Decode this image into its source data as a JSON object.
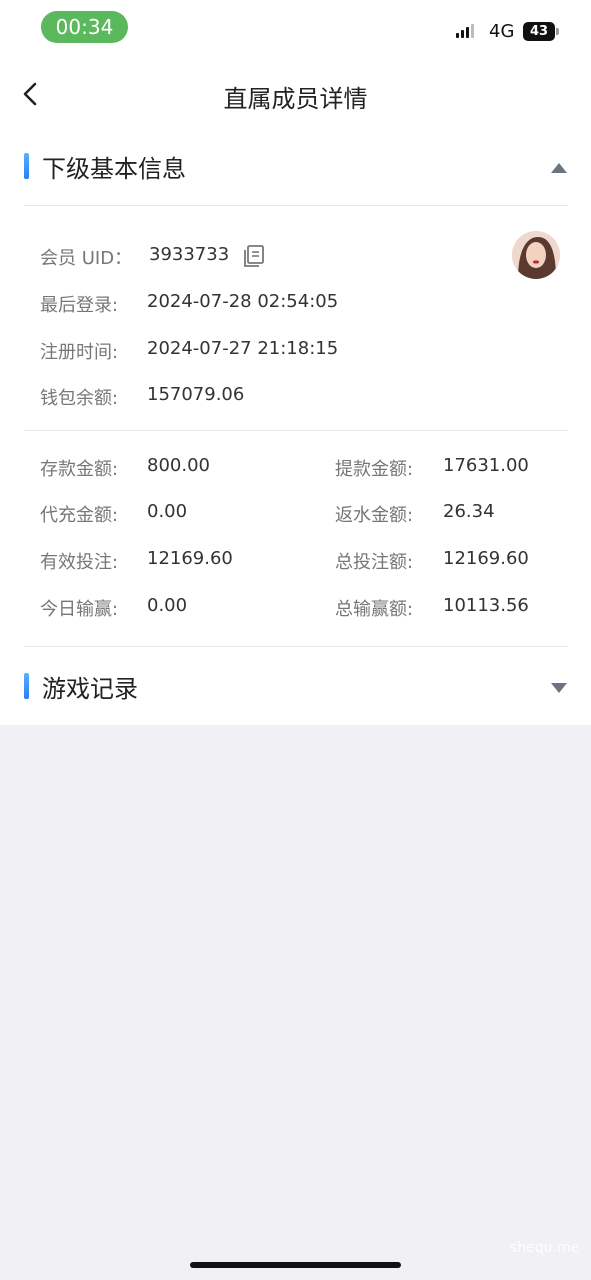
{
  "status_bar": {
    "time": "00:34",
    "network": "4G",
    "battery": "43",
    "signal_icon": "signal-icon"
  },
  "nav": {
    "back_icon": "chevron-left-icon",
    "title": "直属成员详情"
  },
  "basic_info": {
    "title": "下级基本信息",
    "toggle_icon": "triangle-up-icon",
    "accent": "#3d8bf5",
    "uid_label": "会员 UID：",
    "uid_value": "3933733",
    "copy_icon": "copy-icon",
    "last_login_label": "最后登录:",
    "last_login_value": "2024-07-28 02:54:05",
    "register_label": "注册时间:",
    "register_value": "2024-07-27 21:18:15",
    "wallet_label": "钱包余额:",
    "wallet_value": "157079.06",
    "stats": {
      "deposit_label": "存款金额:",
      "deposit_value": "800.00",
      "withdraw_label": "提款金额:",
      "withdraw_value": "17631.00",
      "agent_recharge_label": "代充金额:",
      "agent_recharge_value": "0.00",
      "rebate_label": "返水金额:",
      "rebate_value": "26.34",
      "valid_bet_label": "有效投注:",
      "valid_bet_value": "12169.60",
      "total_bet_label": "总投注额:",
      "total_bet_value": "12169.60",
      "today_winloss_label": "今日输赢:",
      "today_winloss_value": "0.00",
      "total_winloss_label": "总输赢额:",
      "total_winloss_value": "10113.56"
    }
  },
  "game_records": {
    "title": "游戏记录",
    "toggle_icon": "triangle-down-icon"
  },
  "watermark": "shequ.me"
}
